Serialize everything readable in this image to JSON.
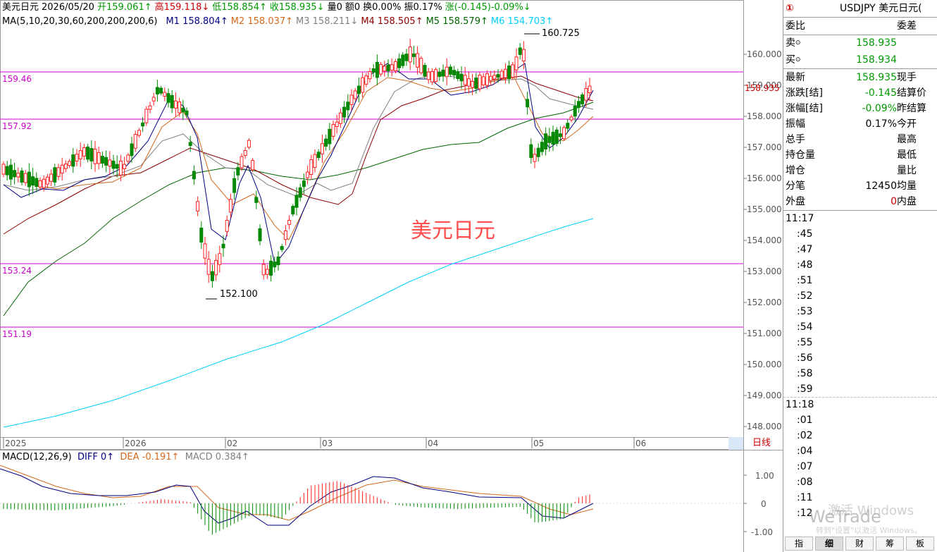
{
  "header": {
    "name": "美元日元",
    "date": "2026/05/20",
    "open": "开159.061↑",
    "high": "高159.118↓",
    "low": "低158.854↑",
    "close": "收158.935↓",
    "volume": "量0",
    "amount": "额0",
    "turnover": "换0.00%",
    "amplitude": "振0.17%",
    "change": "涨(-0.145)-0.09%↓"
  },
  "ma": {
    "label": "MA(5,10,20,30,60,200,200,200,6)",
    "m1": "M1 158.804↑",
    "m2": "M2 158.037↑",
    "m3": "M3 158.211↓",
    "m4": "M4 158.505↑",
    "m5": "M5 158.579↑",
    "m6": "M6 154.703↑",
    "colors": {
      "m1": "#000080",
      "m2": "#d2691e",
      "m3": "#808080",
      "m4": "#8b0000",
      "m5": "#006400",
      "m6": "#00cfff"
    }
  },
  "annotations": {
    "high": "160.725",
    "low": "152.100"
  },
  "levels": [
    "159.46",
    "157.92",
    "153.24",
    "151.19"
  ],
  "price_axis": [
    "160.000",
    "159.000",
    "158.000",
    "157.000",
    "156.000",
    "155.000",
    "154.000",
    "153.000",
    "152.000",
    "151.000",
    "150.000",
    "149.000",
    "148.000"
  ],
  "current_price_tag": "158.935",
  "time_axis": [
    "2025",
    "2026",
    "02",
    "03",
    "04",
    "05",
    "06"
  ],
  "period_tab": "日线",
  "watermark": "美元日元",
  "macd": {
    "label": "MACD(12,26,9)",
    "diff": "DIFF 0↑",
    "dea": "DEA -0.191↑",
    "macd": "MACD 0.384↑",
    "axis": [
      "1.00",
      "0",
      "-1.00"
    ]
  },
  "panel": {
    "badge": "①",
    "title": "USDJPY 美元日元(",
    "weibi": "委比",
    "weicha": "委差",
    "sell_label": "卖",
    "sell_value": "158.935",
    "buy_label": "买",
    "buy_value": "158.934",
    "rows": [
      {
        "label": "最新",
        "value": "158.935",
        "label2": "现手"
      },
      {
        "label": "涨跌[结]",
        "value": "-0.145",
        "label2": "结算价"
      },
      {
        "label": "涨幅[结]",
        "value": "-0.09%",
        "label2": "昨结算"
      },
      {
        "label": "振幅",
        "value": "0.17%",
        "label2": "今开"
      },
      {
        "label": "总手",
        "value": "",
        "label2": "最高"
      },
      {
        "label": "持仓量",
        "value": "",
        "label2": "最低"
      },
      {
        "label": "增仓",
        "value": "",
        "label2": "量比"
      },
      {
        "label": "分笔",
        "value": "12450",
        "label2": "均量"
      },
      {
        "label": "外盘",
        "value": "0",
        "label2": "内盘"
      }
    ],
    "ticks": [
      "11:17",
      ":45",
      ":47",
      ":48",
      ":51",
      ":52",
      ":53",
      ":54",
      ":55",
      ":56",
      ":58",
      ":59",
      "11:18",
      ":01",
      ":02",
      ":04",
      ":07",
      ":08",
      ":11",
      ":12"
    ],
    "tabs": [
      "指",
      "细",
      "财",
      "筹",
      "板"
    ]
  },
  "os_watermark": "激活 Windows",
  "os_watermark2": "转到\"设置\"以激活 Windows。",
  "brand_watermark": "WeTrade"
}
